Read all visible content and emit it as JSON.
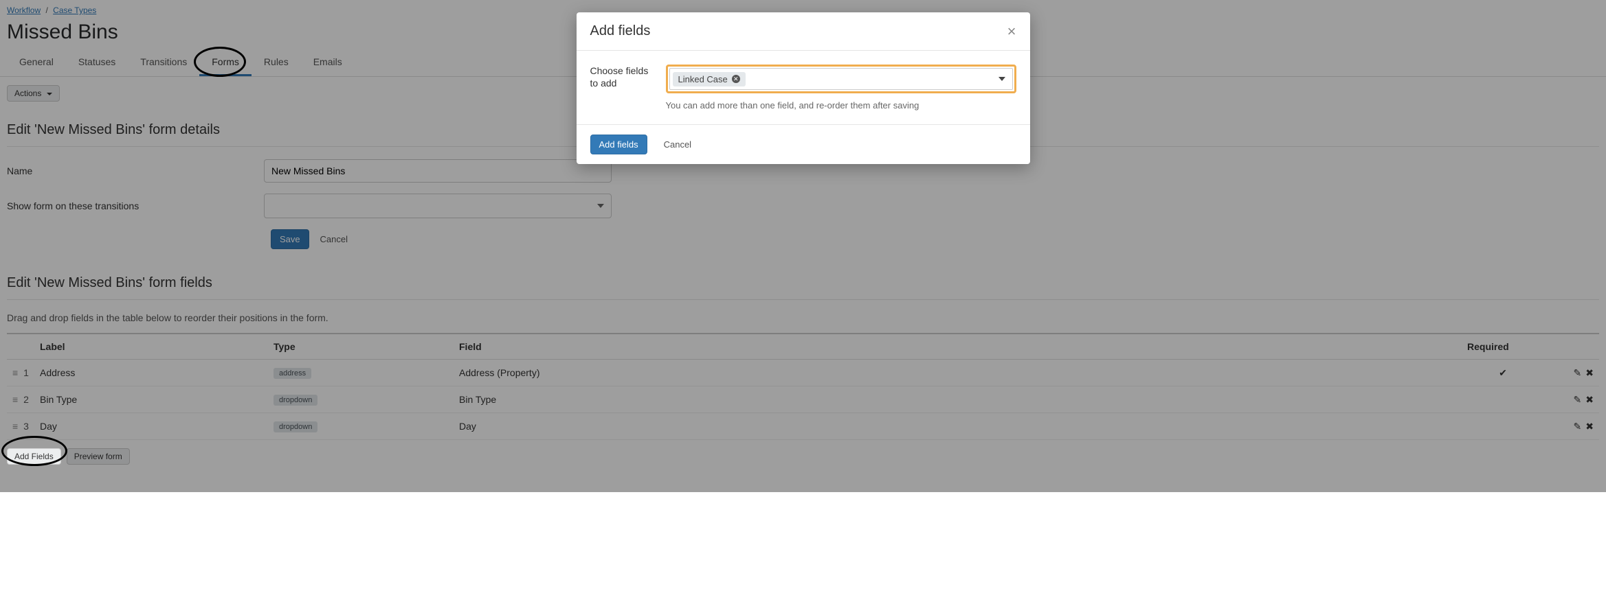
{
  "breadcrumb": {
    "workflow": "Workflow",
    "case_types": "Case Types"
  },
  "page_title": "Missed Bins",
  "tabs": {
    "general": "General",
    "statuses": "Statuses",
    "transitions": "Transitions",
    "forms": "Forms",
    "rules": "Rules",
    "emails": "Emails"
  },
  "actions_label": "Actions",
  "details": {
    "heading": "Edit 'New Missed Bins' form details",
    "name_label": "Name",
    "name_value": "New Missed Bins",
    "transitions_label": "Show form on these transitions",
    "save": "Save",
    "cancel": "Cancel"
  },
  "fields": {
    "heading": "Edit 'New Missed Bins' form fields",
    "hint": "Drag and drop fields in the table below to reorder their positions in the form.",
    "columns": {
      "label": "Label",
      "type": "Type",
      "field": "Field",
      "required": "Required"
    },
    "rows": [
      {
        "num": "1",
        "label": "Address",
        "type": "address",
        "field": "Address (Property)",
        "required": true
      },
      {
        "num": "2",
        "label": "Bin Type",
        "type": "dropdown",
        "field": "Bin Type",
        "required": false
      },
      {
        "num": "3",
        "label": "Day",
        "type": "dropdown",
        "field": "Day",
        "required": false
      }
    ],
    "add_fields": "Add Fields",
    "preview_form": "Preview form"
  },
  "modal": {
    "title": "Add fields",
    "choose_label": "Choose fields to add",
    "token": "Linked Case",
    "hint": "You can add more than one field, and re-order them after saving",
    "submit": "Add fields",
    "cancel": "Cancel"
  }
}
